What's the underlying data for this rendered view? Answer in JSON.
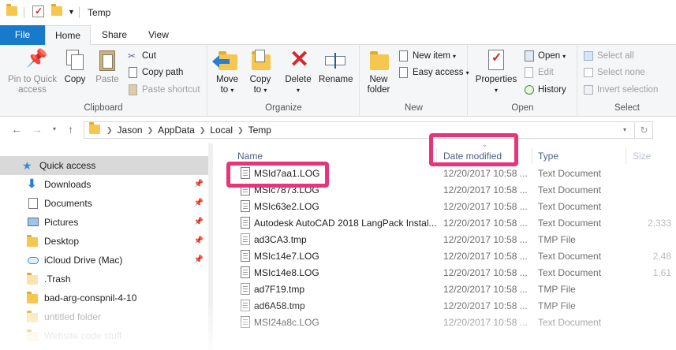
{
  "window": {
    "title": "Temp"
  },
  "tabs": {
    "file": "File",
    "home": "Home",
    "share": "Share",
    "view": "View"
  },
  "ribbon": {
    "clipboard": {
      "label": "Clipboard",
      "pin_line1": "Pin to Quick",
      "pin_line2": "access",
      "copy": "Copy",
      "paste": "Paste",
      "cut": "Cut",
      "copy_path": "Copy path",
      "paste_shortcut": "Paste shortcut"
    },
    "organize": {
      "label": "Organize",
      "move_line1": "Move",
      "move_line2": "to",
      "copy_line1": "Copy",
      "copy_line2": "to",
      "delete": "Delete",
      "rename": "Rename"
    },
    "new": {
      "label": "New",
      "folder_line1": "New",
      "folder_line2": "folder",
      "new_item": "New item",
      "easy_access": "Easy access"
    },
    "open": {
      "label": "Open",
      "properties": "Properties",
      "open": "Open",
      "edit": "Edit",
      "history": "History"
    },
    "select": {
      "label": "Select",
      "select_all": "Select all",
      "select_none": "Select none",
      "invert": "Invert selection"
    }
  },
  "address": {
    "crumbs": [
      "Jason",
      "AppData",
      "Local",
      "Temp"
    ]
  },
  "nav": {
    "items": [
      {
        "label": "Quick access"
      },
      {
        "label": "Downloads"
      },
      {
        "label": "Documents"
      },
      {
        "label": "Pictures"
      },
      {
        "label": "Desktop"
      },
      {
        "label": "iCloud Drive (Mac)"
      },
      {
        "label": ".Trash"
      },
      {
        "label": "bad-arg-conspnil-4-10"
      },
      {
        "label": "untitled folder"
      },
      {
        "label": "Website code stuff"
      }
    ]
  },
  "columns": {
    "name": "Name",
    "date": "Date modified",
    "type": "Type",
    "size": "Size"
  },
  "files": [
    {
      "name": "MSId7aa1.LOG",
      "date": "12/20/2017 10:58 ...",
      "type": "Text Document",
      "size": ""
    },
    {
      "name": "MSIc7873.LOG",
      "date": "12/20/2017 10:58 ...",
      "type": "Text Document",
      "size": ""
    },
    {
      "name": "MSIc63e2.LOG",
      "date": "12/20/2017 10:58 ...",
      "type": "Text Document",
      "size": ""
    },
    {
      "name": "Autodesk AutoCAD 2018 LangPack Instal...",
      "date": "12/20/2017 10:58 ...",
      "type": "Text Document",
      "size": "2,333"
    },
    {
      "name": "ad3CA3.tmp",
      "date": "12/20/2017 10:58 ...",
      "type": "TMP File",
      "size": ""
    },
    {
      "name": "MSIc14e7.LOG",
      "date": "12/20/2017 10:58 ...",
      "type": "Text Document",
      "size": "2,48"
    },
    {
      "name": "MSIc14e8.LOG",
      "date": "12/20/2017 10:58 ...",
      "type": "Text Document",
      "size": "1,61"
    },
    {
      "name": "ad7F19.tmp",
      "date": "12/20/2017 10:58 ...",
      "type": "TMP File",
      "size": ""
    },
    {
      "name": "ad6A58.tmp",
      "date": "12/20/2017 10:58 ...",
      "type": "TMP File",
      "size": ""
    },
    {
      "name": "MSI24a8c.LOG",
      "date": "12/20/2017 10:58 ...",
      "type": "Text Document",
      "size": ""
    }
  ],
  "colors": {
    "file_tab": "#1979ca",
    "highlight": "#e8347a",
    "selected_nav": "#d9d9d9"
  }
}
